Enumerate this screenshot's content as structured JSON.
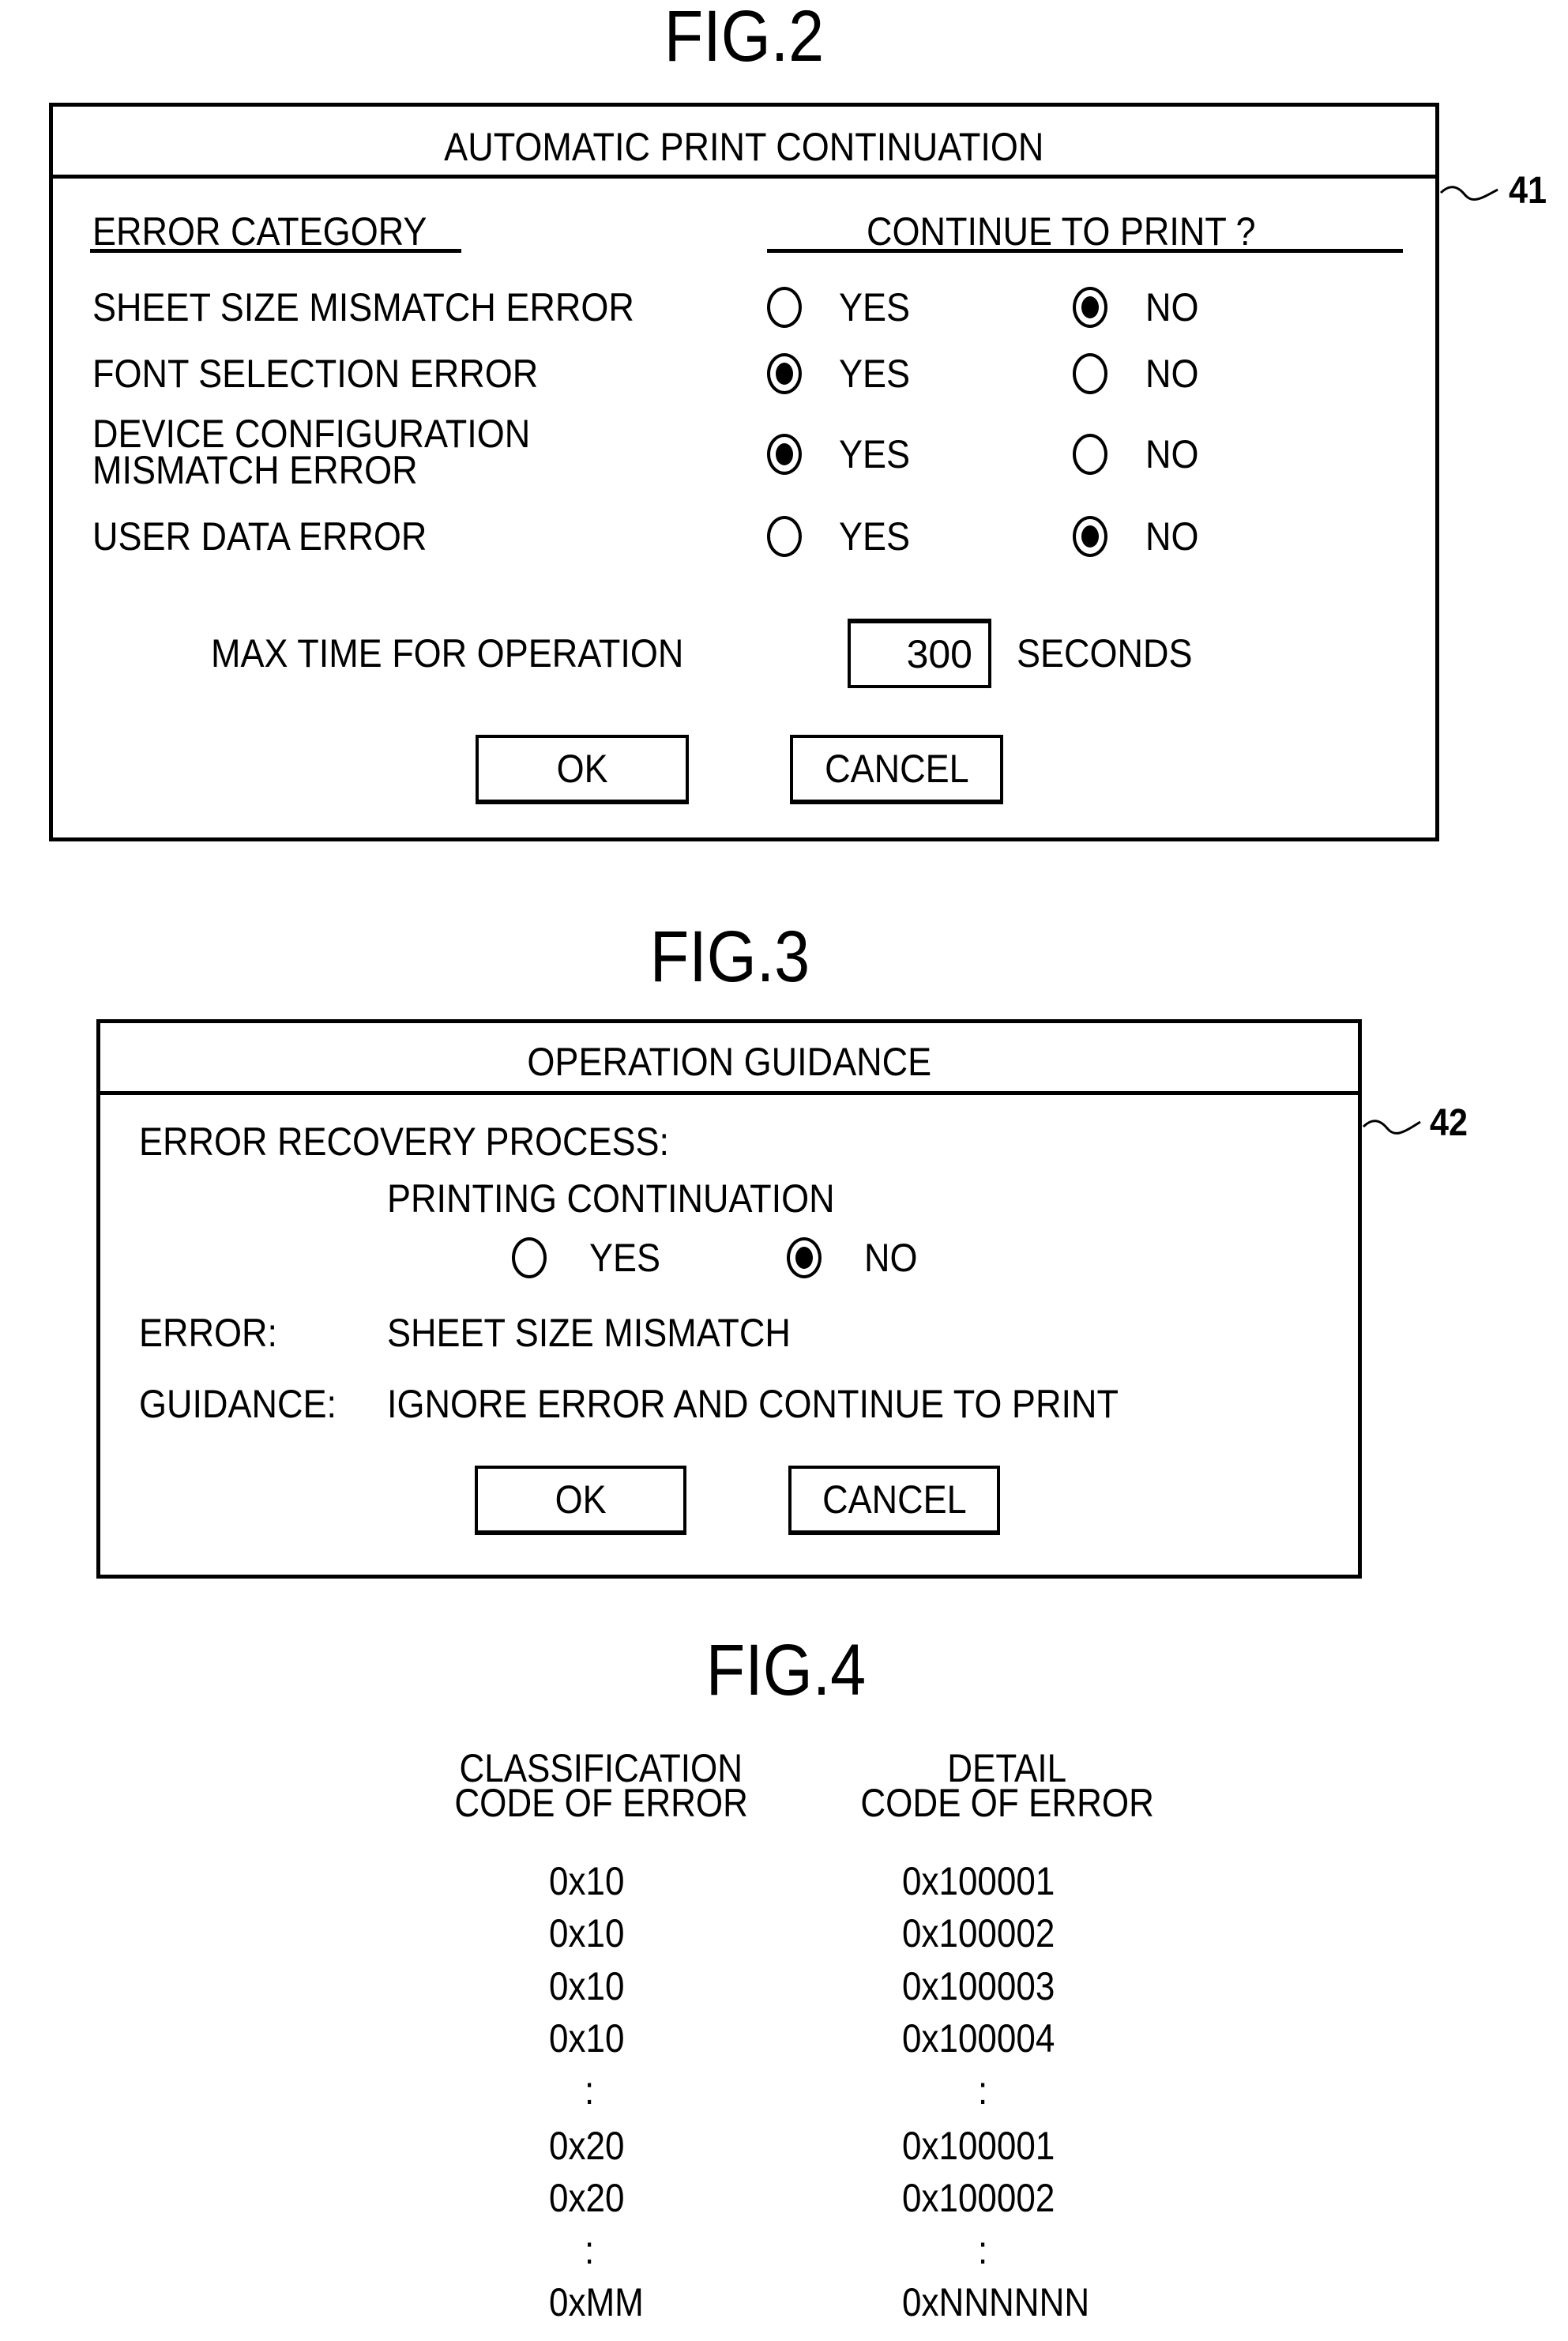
{
  "fig2": {
    "figure_label": "FIG.2",
    "reference_numeral": "41",
    "dialog_title": "AUTOMATIC PRINT CONTINUATION",
    "column_headers": {
      "category": "ERROR CATEGORY",
      "continue": "CONTINUE TO PRINT ?"
    },
    "options": {
      "yes": "YES",
      "no": "NO"
    },
    "rows": [
      {
        "label_lines": [
          "SHEET SIZE MISMATCH ERROR"
        ],
        "selected": "NO"
      },
      {
        "label_lines": [
          "FONT SELECTION ERROR"
        ],
        "selected": "YES"
      },
      {
        "label_lines": [
          "DEVICE CONFIGURATION",
          "MISMATCH ERROR"
        ],
        "selected": "YES"
      },
      {
        "label_lines": [
          "USER DATA ERROR"
        ],
        "selected": "NO"
      }
    ],
    "max_time": {
      "label": "MAX TIME FOR OPERATION",
      "value": "300",
      "unit": "SECONDS"
    },
    "buttons": {
      "ok": "OK",
      "cancel": "CANCEL"
    }
  },
  "fig3": {
    "figure_label": "FIG.3",
    "reference_numeral": "42",
    "dialog_title": "OPERATION GUIDANCE",
    "recovery_label": "ERROR RECOVERY PROCESS:",
    "printing_continuation_label": "PRINTING CONTINUATION",
    "options": {
      "yes": "YES",
      "no": "NO"
    },
    "selected": "NO",
    "error_label": "ERROR:",
    "error_value": "SHEET SIZE MISMATCH",
    "guidance_label": "GUIDANCE:",
    "guidance_value": "IGNORE ERROR AND CONTINUE TO PRINT",
    "buttons": {
      "ok": "OK",
      "cancel": "CANCEL"
    }
  },
  "fig4": {
    "figure_label": "FIG.4",
    "headers": {
      "classification": [
        "CLASSIFICATION",
        "CODE OF ERROR"
      ],
      "detail": [
        "DETAIL",
        "CODE OF ERROR"
      ]
    },
    "rows": [
      {
        "classification": "0x10",
        "detail": "0x100001"
      },
      {
        "classification": "0x10",
        "detail": "0x100002"
      },
      {
        "classification": "0x10",
        "detail": "0x100003"
      },
      {
        "classification": "0x10",
        "detail": "0x100004"
      },
      {
        "classification": ":",
        "detail": ":"
      },
      {
        "classification": "0x20",
        "detail": "0x100001"
      },
      {
        "classification": "0x20",
        "detail": "0x100002"
      },
      {
        "classification": ":",
        "detail": ":"
      },
      {
        "classification": "0xMM",
        "detail": "0xNNNNNN"
      }
    ]
  }
}
